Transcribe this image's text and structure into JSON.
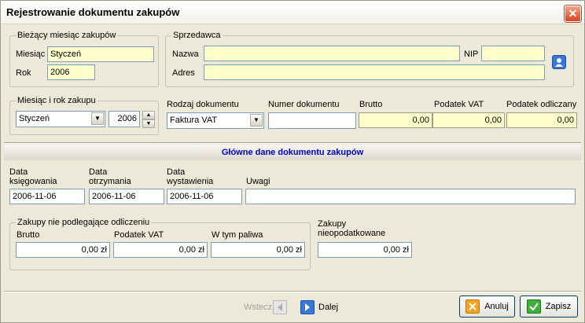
{
  "window": {
    "title": "Rejestrowanie dokumentu zakupów",
    "close_glyph": "✕"
  },
  "month_group": {
    "legend": "Bieżący miesiąc zakupów",
    "month_label": "Miesiąc",
    "month_value": "Styczeń",
    "year_label": "Rok",
    "year_value": "2006"
  },
  "seller_group": {
    "legend": "Sprzedawca",
    "name_label": "Nazwa",
    "name_value": "",
    "nip_label": "NIP",
    "nip_value": "",
    "address_label": "Adres",
    "address_value": "",
    "contact_icon": "person-card-icon"
  },
  "purchase_period": {
    "legend": "Miesiąc i rok zakupu",
    "month_value": "Styczeń",
    "year_value": "2006"
  },
  "document": {
    "type_label": "Rodzaj dokumentu",
    "type_value": "Faktura VAT",
    "number_label": "Numer dokumentu",
    "number_value": "",
    "gross_label": "Brutto",
    "gross_value": "0,00",
    "vat_label": "Podatek VAT",
    "vat_value": "0,00",
    "deducted_label": "Podatek odliczany",
    "deducted_value": "0,00"
  },
  "section_title": "Główne dane dokumentu zakupów",
  "dates": {
    "booking_label_1": "Data",
    "booking_label_2": "księgowania",
    "booking_value": "2006-11-06",
    "received_label_1": "Data",
    "received_label_2": "otrzymania",
    "received_value": "2006-11-06",
    "issued_label_1": "Data",
    "issued_label_2": "wystawienia",
    "issued_value": "2006-11-06",
    "notes_label": "Uwagi",
    "notes_value": ""
  },
  "non_deductible": {
    "legend": "Zakupy nie podlegające odliczeniu",
    "gross_label": "Brutto",
    "gross_value": "0,00 zł",
    "vat_label": "Podatek VAT",
    "vat_value": "0,00 zł",
    "fuel_label": "W tym paliwa",
    "fuel_value": "0,00 zł"
  },
  "untaxed": {
    "label_1": "Zakupy",
    "label_2": "nieopodatkowane",
    "value": "0,00 zł"
  },
  "nav": {
    "back_label": "Wstecz",
    "next_label": "Dalej"
  },
  "buttons": {
    "cancel_label": "Anuluj",
    "save_label": "Zapisz"
  },
  "colors": {
    "accent": "#0000cc",
    "field_yellow": "#ffffcc",
    "window_bg": "#ece9d8"
  }
}
